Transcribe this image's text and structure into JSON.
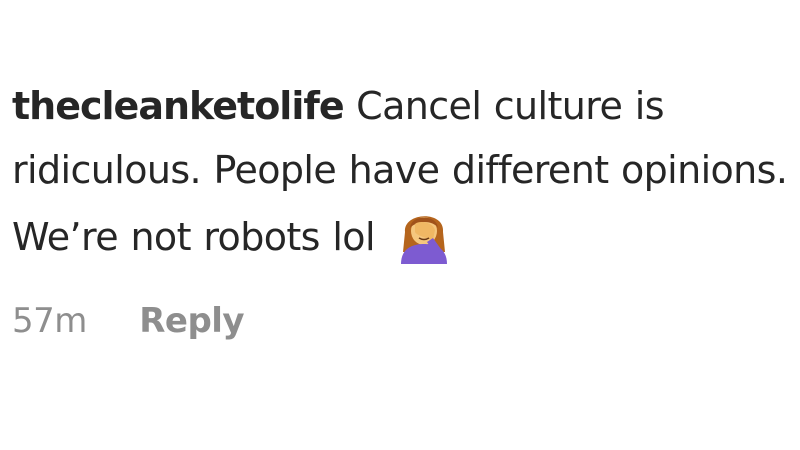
{
  "comment": {
    "username": "thecleanketolife",
    "text": "Cancel culture is ridiculous. People have different opinions. We’re not robots lol",
    "emoji": "woman-facepalming-icon",
    "timestamp": "57m",
    "reply_label": "Reply"
  }
}
